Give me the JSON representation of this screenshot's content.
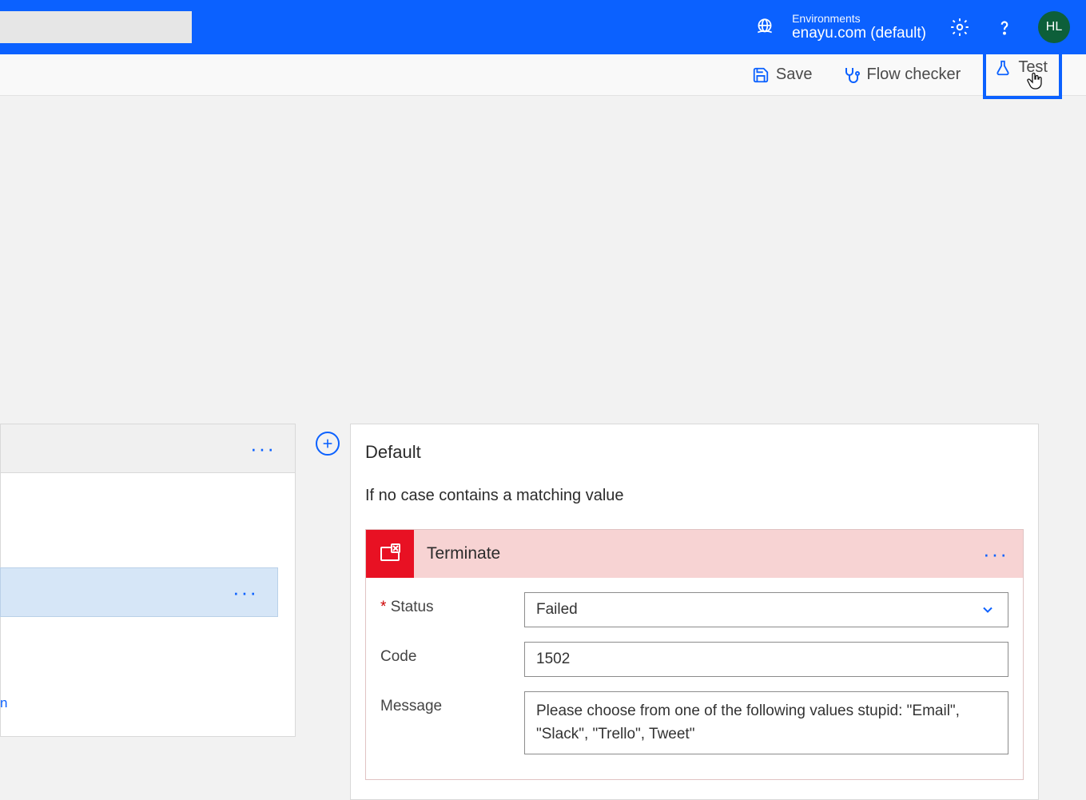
{
  "header": {
    "environments_label": "Environments",
    "environment_name": "enayu.com (default)",
    "avatar_initials": "HL"
  },
  "toolbar": {
    "save_label": "Save",
    "flow_checker_label": "Flow checker",
    "test_label": "Test"
  },
  "left": {
    "fragment_text": "n"
  },
  "case": {
    "title": "Default",
    "description": "If no case contains a matching value"
  },
  "action": {
    "title": "Terminate",
    "status_label": "Status",
    "status_value": "Failed",
    "code_label": "Code",
    "code_value": "1502",
    "message_label": "Message",
    "message_value": "Please choose from one of the following values stupid: \"Email\", \"Slack\", \"Trello\", Tweet\""
  }
}
